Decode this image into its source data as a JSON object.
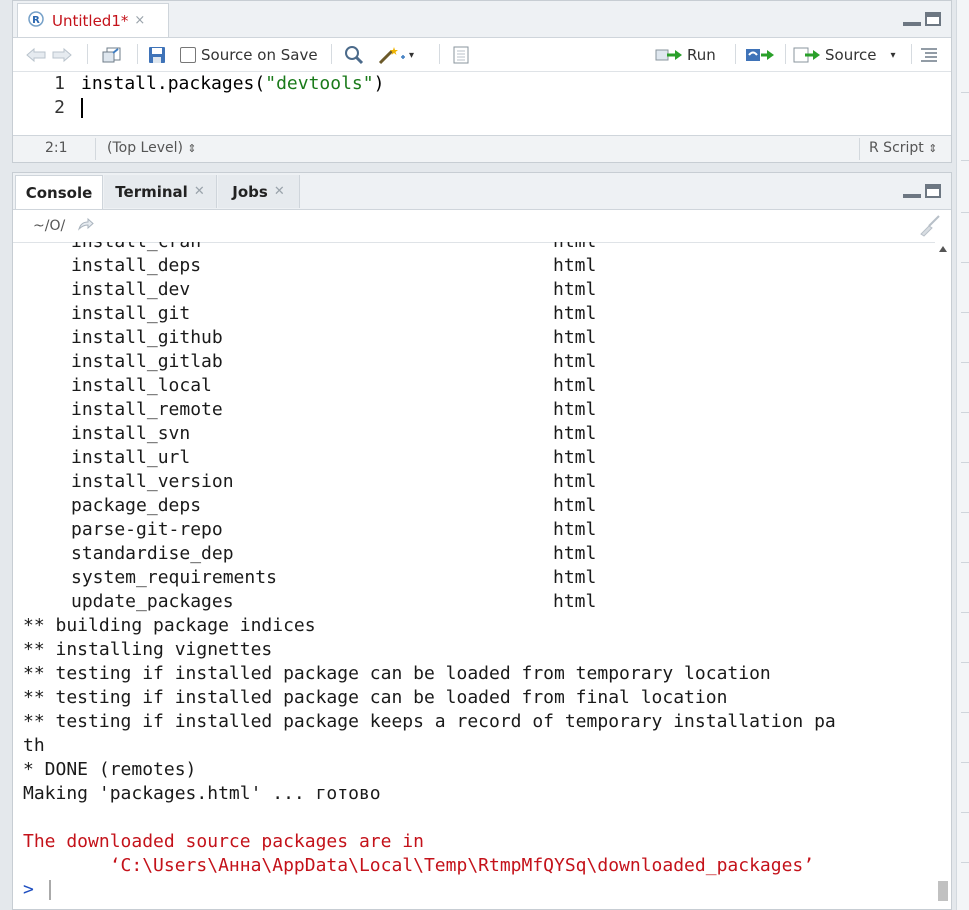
{
  "editor": {
    "tab": {
      "title": "Untitled1*",
      "close": "×"
    },
    "toolbar": {
      "source_on_save": "Source on Save",
      "source_on_save_checked": false,
      "run": "Run",
      "source": "Source"
    },
    "lines": [
      {
        "number": "1",
        "code_prefix": "install.packages(",
        "code_string": "\"devtools\"",
        "code_suffix": ")"
      },
      {
        "number": "2",
        "code_prefix": "",
        "code_string": "",
        "code_suffix": ""
      }
    ],
    "status": {
      "position": "2:1",
      "scope": "(Top Level)",
      "file_type": "R Script"
    }
  },
  "console": {
    "tabs": [
      {
        "label": "Console",
        "active": true
      },
      {
        "label": "Terminal",
        "active": false
      },
      {
        "label": "Jobs",
        "active": false
      }
    ],
    "path": "~/O/",
    "partial_line": {
      "name": "install_cran",
      "type": "html"
    },
    "help_entries": [
      {
        "name": "install_deps",
        "type": "html"
      },
      {
        "name": "install_dev",
        "type": "html"
      },
      {
        "name": "install_git",
        "type": "html"
      },
      {
        "name": "install_github",
        "type": "html"
      },
      {
        "name": "install_gitlab",
        "type": "html"
      },
      {
        "name": "install_local",
        "type": "html"
      },
      {
        "name": "install_remote",
        "type": "html"
      },
      {
        "name": "install_svn",
        "type": "html"
      },
      {
        "name": "install_url",
        "type": "html"
      },
      {
        "name": "install_version",
        "type": "html"
      },
      {
        "name": "package_deps",
        "type": "html"
      },
      {
        "name": "parse-git-repo",
        "type": "html"
      },
      {
        "name": "standardise_dep",
        "type": "html"
      },
      {
        "name": "system_requirements",
        "type": "html"
      },
      {
        "name": "update_packages",
        "type": "html"
      }
    ],
    "output_lines": [
      "** building package indices",
      "** installing vignettes",
      "** testing if installed package can be loaded from temporary location",
      "** testing if installed package can be loaded from final location",
      "** testing if installed package keeps a record of temporary installation pa",
      "th",
      "* DONE (remotes)",
      "Making 'packages.html' ... готово"
    ],
    "message_lines": [
      "The downloaded source packages are in",
      "        ‘C:\\Users\\Анна\\AppData\\Local\\Temp\\RtmpMfQYSq\\downloaded_packages’"
    ],
    "prompt": ">"
  },
  "colors": {
    "string": "#1a7a1a",
    "error_message": "#c4121a",
    "prompt": "#1f4fc1",
    "modified_tab_title": "#c4121a"
  },
  "icons": [
    "r-file-icon",
    "back-arrow-icon",
    "forward-arrow-icon",
    "show-in-window-icon",
    "save-icon",
    "search-icon",
    "magic-wand-icon",
    "notebook-icon",
    "run-arrow-icon",
    "rerun-icon",
    "source-icon",
    "outline-icon",
    "broom-icon"
  ]
}
